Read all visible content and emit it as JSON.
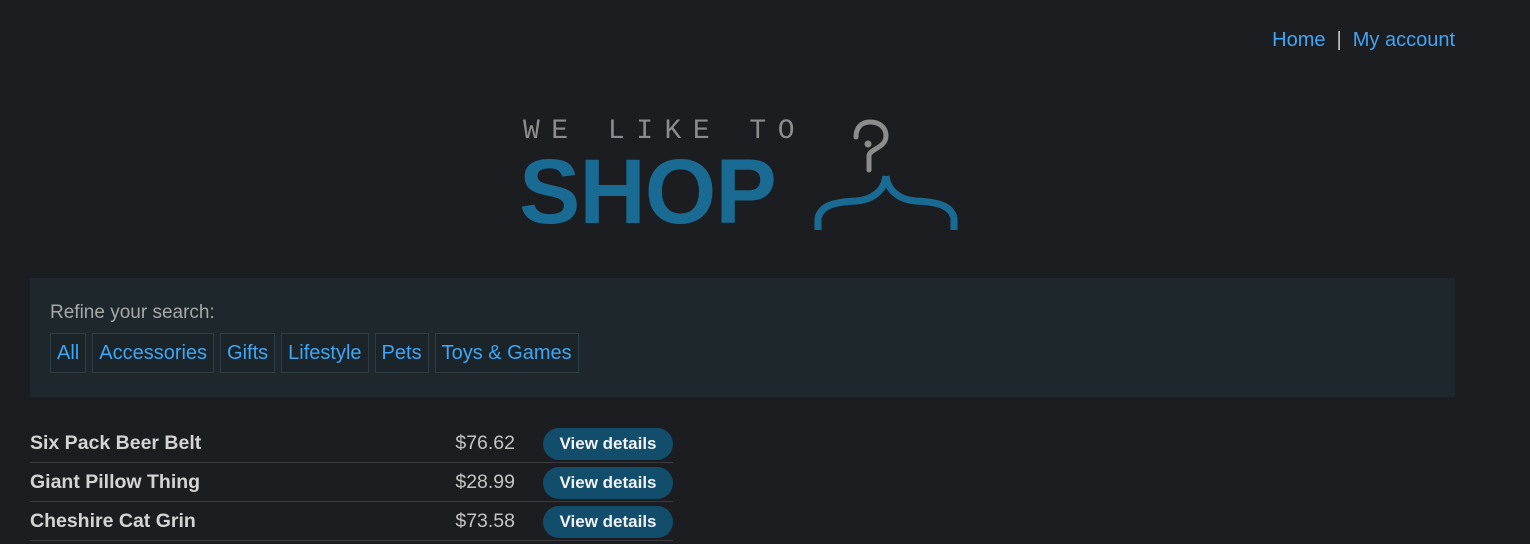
{
  "nav": {
    "home": "Home",
    "separator": "|",
    "my_account": "My account"
  },
  "logo": {
    "tagline": "WE LIKE TO",
    "word": "SHOP",
    "icon": "hanger-icon"
  },
  "filters": {
    "label": "Refine your search:",
    "items": [
      {
        "label": "All"
      },
      {
        "label": "Accessories"
      },
      {
        "label": "Gifts"
      },
      {
        "label": "Lifestyle"
      },
      {
        "label": "Pets"
      },
      {
        "label": "Toys & Games"
      }
    ]
  },
  "products": [
    {
      "name": "Six Pack Beer Belt",
      "price": "$76.62",
      "button": "View details"
    },
    {
      "name": "Giant Pillow Thing",
      "price": "$28.99",
      "button": "View details"
    },
    {
      "name": "Cheshire Cat Grin",
      "price": "$73.58",
      "button": "View details"
    }
  ],
  "colors": {
    "background": "#1c1d20",
    "link": "#3fa5f5",
    "brand": "#1a6b94",
    "button": "#124d6b"
  }
}
